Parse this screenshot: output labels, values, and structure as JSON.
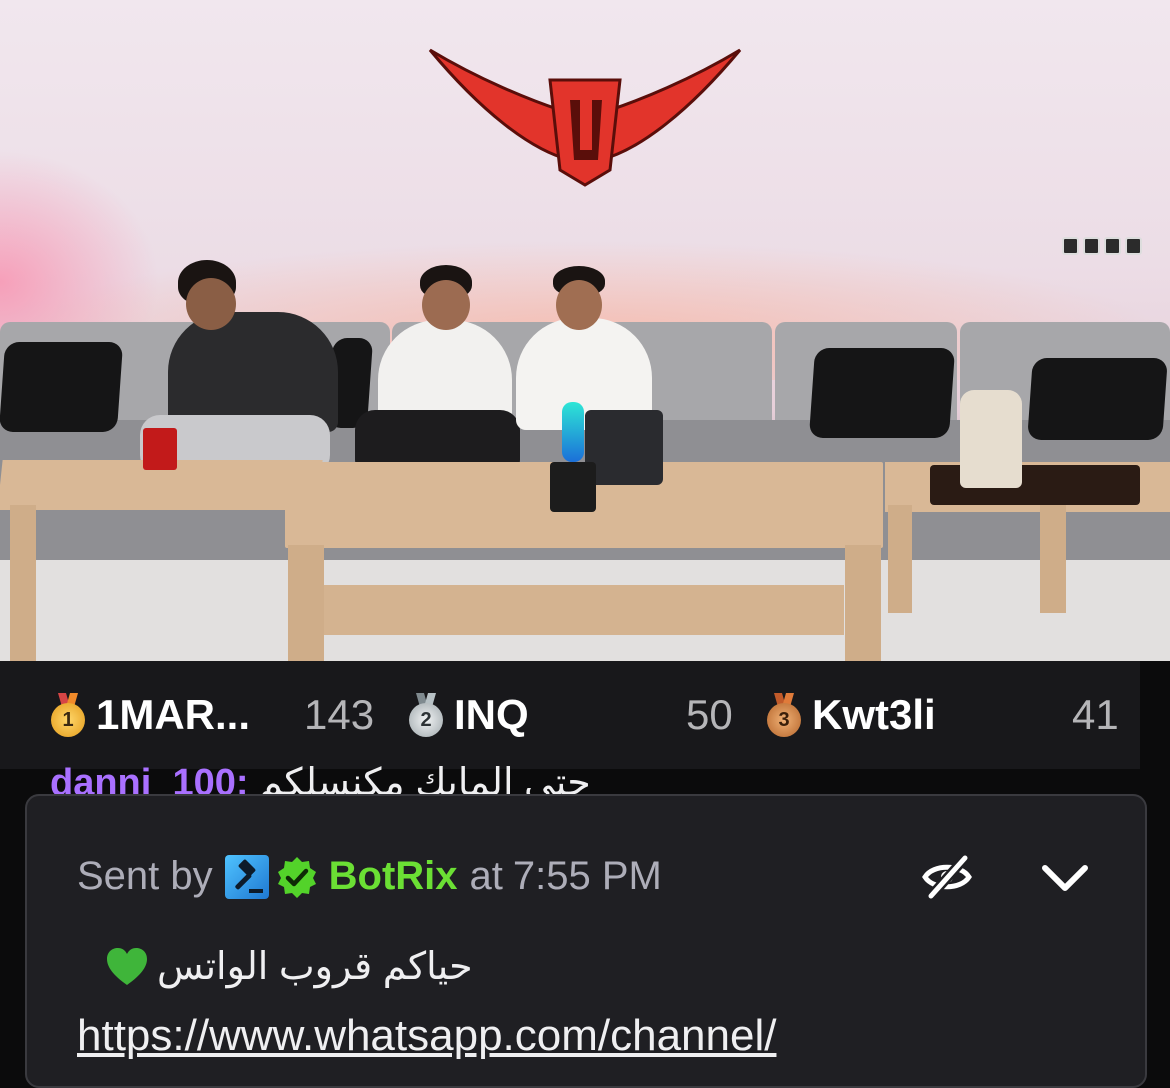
{
  "leaderboard": {
    "entries": [
      {
        "rank": "1",
        "name": "1MAR...",
        "count": "143",
        "medal": "gold-medal-icon"
      },
      {
        "rank": "2",
        "name": "INQ",
        "count": "50",
        "medal": "silver-medal-icon"
      },
      {
        "rank": "3",
        "name": "Kwt3li",
        "count": "41",
        "medal": "bronze-medal-icon"
      }
    ]
  },
  "chat": {
    "partial_line": {
      "user": "danni_100",
      "separator": ":",
      "message": "حتى المايك مكنسلكم"
    }
  },
  "pinned_message": {
    "sent_by_label": "Sent by",
    "sender": "BotRix",
    "at_label": "at",
    "time": "7:55 PM",
    "text": "حياكم قروب الواتس",
    "link": "https://www.whatsapp.com/channel/"
  },
  "colors": {
    "accent_username": "#a970ff",
    "bot_name": "#6bdf34",
    "card_bg": "#1f1f23",
    "leaderboard_bg": "#18181b"
  }
}
